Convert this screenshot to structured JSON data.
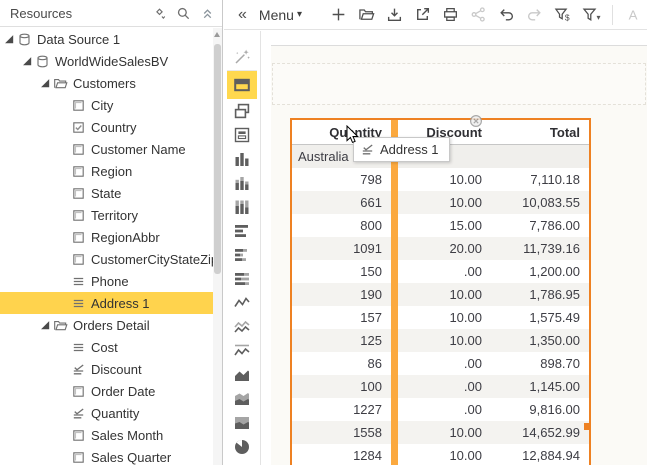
{
  "colors": {
    "accent_orange": "#EE8122",
    "drop_indicator_orange": "#FBA93F",
    "selection_yellow": "#FFD34D",
    "alt_row": "#F4F3F0",
    "group_row": "#F0EFEC"
  },
  "resources_panel": {
    "title": "Resources",
    "header_icons": [
      "expand-collapse-icon",
      "search-icon",
      "collapse-panel-icon"
    ]
  },
  "tree": {
    "items": [
      {
        "label": "Data Source 1",
        "level": 0,
        "icon": "datasource-icon",
        "expanded": true
      },
      {
        "label": "WorldWideSalesBV",
        "level": 1,
        "icon": "datasource-icon",
        "expanded": true
      },
      {
        "label": "Customers",
        "level": 2,
        "icon": "folder-open-icon",
        "expanded": true
      },
      {
        "label": "City",
        "level": 3,
        "icon": "field-icon"
      },
      {
        "label": "Country",
        "level": 3,
        "icon": "field-checked-icon"
      },
      {
        "label": "Customer Name",
        "level": 3,
        "icon": "field-icon"
      },
      {
        "label": "Region",
        "level": 3,
        "icon": "field-icon"
      },
      {
        "label": "State",
        "level": 3,
        "icon": "field-icon"
      },
      {
        "label": "Territory",
        "level": 3,
        "icon": "field-icon"
      },
      {
        "label": "RegionAbbr",
        "level": 3,
        "icon": "field-icon"
      },
      {
        "label": "CustomerCityStateZip",
        "level": 3,
        "icon": "field-icon"
      },
      {
        "label": "Phone",
        "level": 3,
        "icon": "field-lines-icon"
      },
      {
        "label": "Address 1",
        "level": 3,
        "icon": "field-lines-icon",
        "selected": true
      },
      {
        "label": "Orders Detail",
        "level": 2,
        "icon": "folder-open-icon",
        "expanded": true
      },
      {
        "label": "Cost",
        "level": 3,
        "icon": "field-lines-icon"
      },
      {
        "label": "Discount",
        "level": 3,
        "icon": "field-check-lines-icon"
      },
      {
        "label": "Order Date",
        "level": 3,
        "icon": "field-icon"
      },
      {
        "label": "Quantity",
        "level": 3,
        "icon": "field-check-lines-icon"
      },
      {
        "label": "Sales Month",
        "level": 3,
        "icon": "field-icon"
      },
      {
        "label": "Sales Quarter",
        "level": 3,
        "icon": "field-icon"
      }
    ]
  },
  "toolbar": {
    "collapse_label": "«",
    "menu_label": "Menu",
    "menu_caret": "▾",
    "items": [
      {
        "name": "new",
        "icon": "plus-icon"
      },
      {
        "name": "open",
        "icon": "open-folder-icon"
      },
      {
        "name": "save",
        "icon": "save-icon"
      },
      {
        "name": "export",
        "icon": "export-icon"
      },
      {
        "name": "print",
        "icon": "print-icon"
      },
      {
        "name": "share",
        "icon": "share-icon",
        "disabled": true
      },
      {
        "name": "undo",
        "icon": "undo-icon"
      },
      {
        "name": "redo",
        "icon": "redo-icon",
        "disabled": true
      },
      {
        "name": "filter-currency",
        "icon": "filter-currency-icon"
      },
      {
        "name": "filter",
        "icon": "filter-icon",
        "caret": true
      },
      {
        "name": "sep"
      },
      {
        "name": "font-color",
        "icon": "font-icon",
        "disabled": true
      },
      {
        "name": "fill-color",
        "icon": "bucket-icon",
        "disabled": true
      },
      {
        "name": "align",
        "icon": "align-icon",
        "disabled": true,
        "caret": true
      }
    ]
  },
  "palette": {
    "selected": "table",
    "items": [
      {
        "name": "wizard",
        "icon": "magic-wand-icon"
      },
      {
        "name": "table",
        "icon": "table-icon"
      },
      {
        "name": "crosstab",
        "icon": "crosstab-icon"
      },
      {
        "name": "list",
        "icon": "list-icon"
      },
      {
        "name": "column-chart",
        "icon": "column-chart-icon"
      },
      {
        "name": "stacked-column-chart",
        "icon": "stacked-column-chart-icon"
      },
      {
        "name": "stacked100-column-chart",
        "icon": "stacked100-column-chart-icon"
      },
      {
        "name": "bar-chart",
        "icon": "bar-chart-icon"
      },
      {
        "name": "stacked-bar-chart",
        "icon": "stacked-bar-chart-icon"
      },
      {
        "name": "stacked100-bar-chart",
        "icon": "stacked100-bar-chart-icon"
      },
      {
        "name": "line-chart",
        "icon": "line-chart-icon"
      },
      {
        "name": "stacked-line-chart",
        "icon": "stacked-line-chart-icon"
      },
      {
        "name": "stacked100-line-chart",
        "icon": "stacked100-line-chart-icon"
      },
      {
        "name": "area-chart",
        "icon": "area-chart-icon"
      },
      {
        "name": "stacked-area-chart",
        "icon": "stacked-area-chart-icon"
      },
      {
        "name": "stacked100-area-chart",
        "icon": "stacked100-area-chart-icon"
      },
      {
        "name": "pie-chart",
        "icon": "pie-chart-icon"
      }
    ]
  },
  "design": {
    "table": {
      "headers": [
        "Quantity",
        "Discount",
        "Total"
      ],
      "group_label": "Australia",
      "rows": [
        [
          "798",
          "10.00",
          "7,110.18"
        ],
        [
          "661",
          "10.00",
          "10,083.55"
        ],
        [
          "800",
          "15.00",
          "7,786.00"
        ],
        [
          "1091",
          "20.00",
          "11,739.16"
        ],
        [
          "150",
          ".00",
          "1,200.00"
        ],
        [
          "190",
          "10.00",
          "1,786.95"
        ],
        [
          "157",
          "10.00",
          "1,575.49"
        ],
        [
          "125",
          "10.00",
          "1,350.00"
        ],
        [
          "86",
          ".00",
          "898.70"
        ],
        [
          "100",
          ".00",
          "1,145.00"
        ],
        [
          "1227",
          ".00",
          "9,816.00"
        ],
        [
          "1558",
          "10.00",
          "14,652.99"
        ],
        [
          "1284",
          "10.00",
          "12,884.94"
        ]
      ]
    },
    "drag_tooltip": {
      "label": "Address 1",
      "icon": "field-check-lines-icon"
    }
  }
}
